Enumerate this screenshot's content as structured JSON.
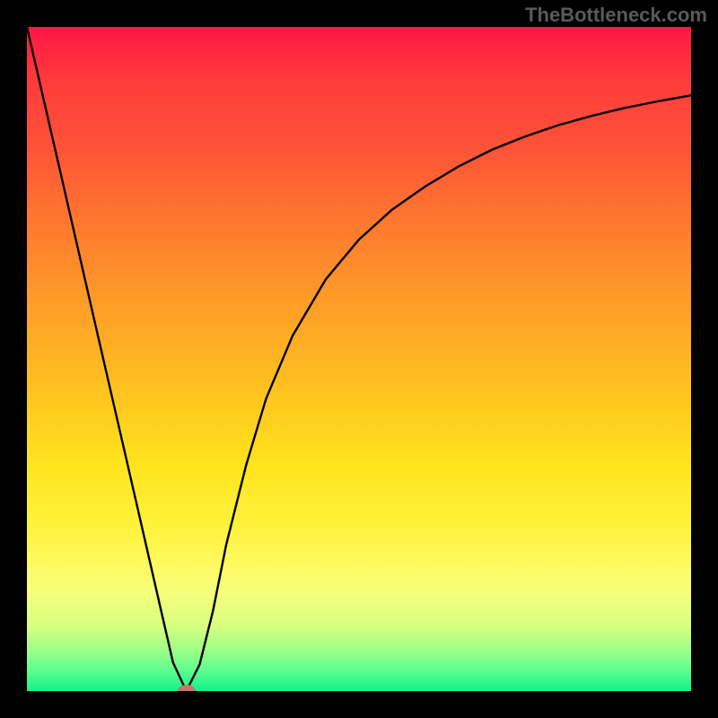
{
  "watermark": "TheBottleneck.com",
  "chart_data": {
    "type": "line",
    "title": "",
    "xlabel": "",
    "ylabel": "",
    "x_range": [
      0,
      100
    ],
    "y_range": [
      0,
      100
    ],
    "series": [
      {
        "name": "curve",
        "x": [
          0,
          5,
          10,
          15,
          20,
          22,
          24,
          26,
          28,
          30,
          33,
          36,
          40,
          45,
          50,
          55,
          60,
          65,
          70,
          75,
          80,
          85,
          90,
          95,
          100
        ],
        "y": [
          100,
          78.3,
          56.5,
          34.8,
          13.0,
          4.3,
          0.0,
          4.0,
          12.0,
          22.0,
          34.0,
          44.0,
          53.5,
          62.0,
          68.0,
          72.5,
          76.0,
          79.0,
          81.5,
          83.5,
          85.2,
          86.6,
          87.8,
          88.8,
          89.7
        ]
      }
    ],
    "marker": {
      "x": 24,
      "y": 0,
      "color": "#c9736a"
    },
    "background_gradient": {
      "stops": [
        {
          "pos": 0,
          "color": "#ff1744"
        },
        {
          "pos": 18,
          "color": "#ff5238"
        },
        {
          "pos": 42,
          "color": "#ff9e28"
        },
        {
          "pos": 66,
          "color": "#ffe41e"
        },
        {
          "pos": 85,
          "color": "#f6ff7a"
        },
        {
          "pos": 100,
          "color": "#12f18b"
        }
      ]
    },
    "frame_color": "#000000"
  }
}
